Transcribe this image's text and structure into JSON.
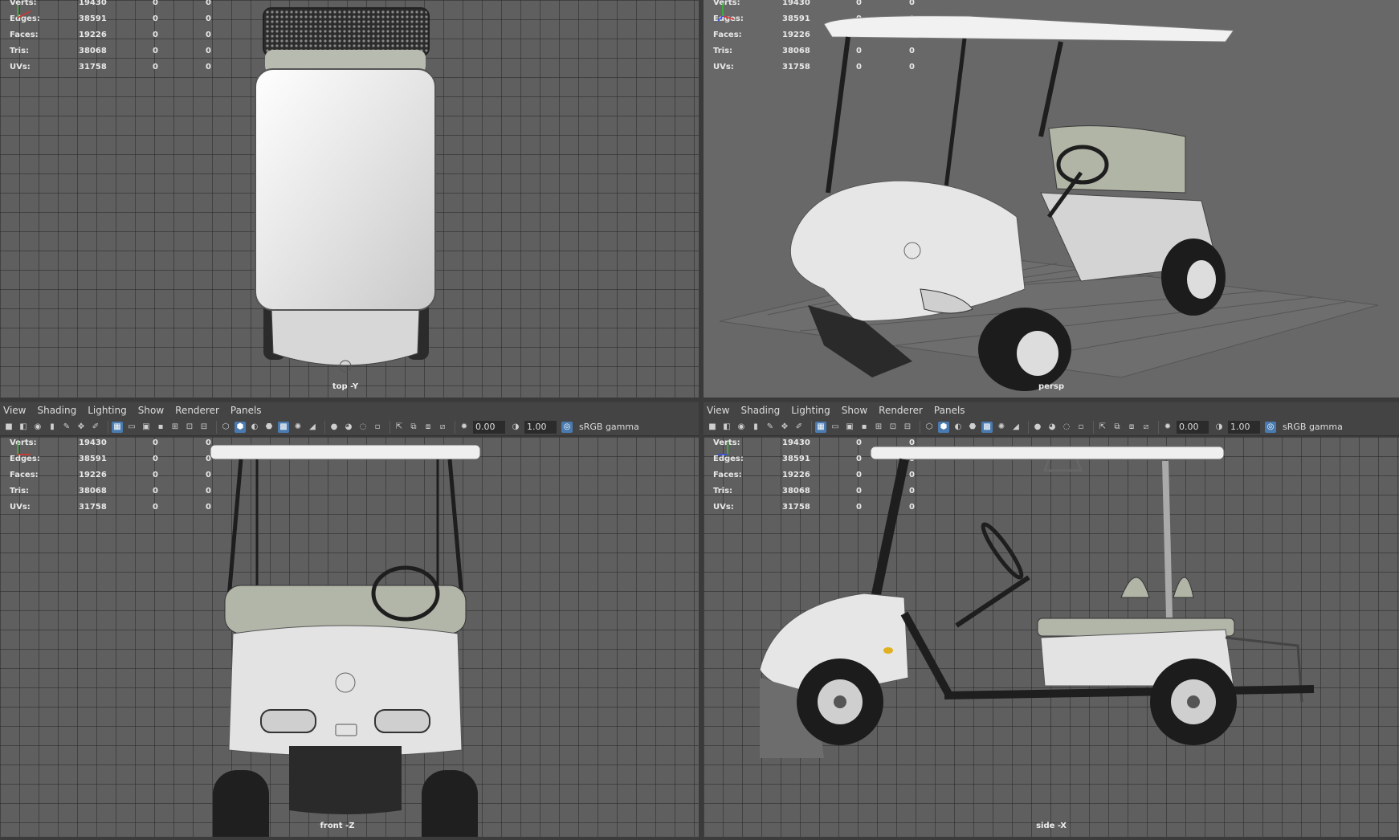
{
  "stats": [
    {
      "label": "Verts:",
      "value": "19430",
      "sel": "0",
      "comp": "0"
    },
    {
      "label": "Edges:",
      "value": "38591",
      "sel": "0",
      "comp": "0"
    },
    {
      "label": "Faces:",
      "value": "19226",
      "sel": "0",
      "comp": "0"
    },
    {
      "label": "Tris:",
      "value": "38068",
      "sel": "0",
      "comp": "0"
    },
    {
      "label": "UVs:",
      "value": "31758",
      "sel": "0",
      "comp": "0"
    }
  ],
  "viewports": {
    "top": {
      "camera": "top -Y"
    },
    "persp": {
      "camera": "persp"
    },
    "front": {
      "camera": "front -Z"
    },
    "side": {
      "camera": "side -X"
    }
  },
  "menus": [
    "View",
    "Shading",
    "Lighting",
    "Show",
    "Renderer",
    "Panels"
  ],
  "toolbar": {
    "exposure": "0.00",
    "gamma": "1.00",
    "colorspace": "sRGB gamma"
  },
  "colors": {
    "accent": "#4a7bb0",
    "viewport_bg": "#5f5f5f",
    "grid": "#4a4a4a",
    "axis_x": "#e03030",
    "axis_y": "#30c030",
    "axis_z": "#3050ff"
  }
}
